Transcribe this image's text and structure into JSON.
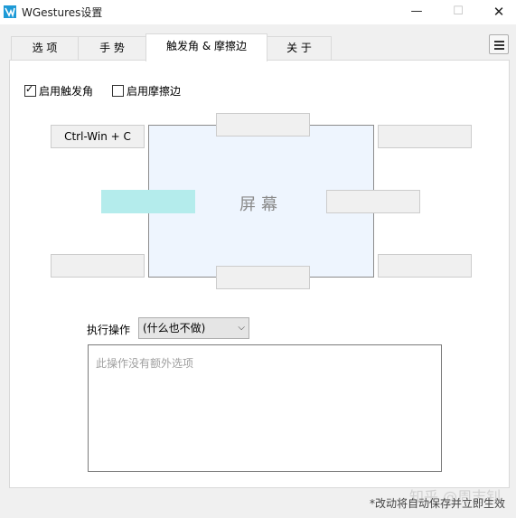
{
  "window": {
    "title": "WGestures设置",
    "min_glyph": "—",
    "max_glyph": "☐",
    "close_glyph": "✕"
  },
  "tabs": [
    {
      "label": "选 项",
      "active": false
    },
    {
      "label": "手 势",
      "active": false
    },
    {
      "label": "触发角 & 摩擦边",
      "active": true
    },
    {
      "label": "关 于",
      "active": false
    }
  ],
  "checkboxes": {
    "corner": {
      "label": "启用触发角",
      "checked": true,
      "mark": "✓"
    },
    "edge": {
      "label": "启用摩擦边",
      "checked": false
    }
  },
  "screen": {
    "label": "屏幕",
    "slots": {
      "top_left": "Ctrl-Win + C",
      "top_edge": "",
      "top_right": "",
      "left_edge": "",
      "right_edge": "",
      "bottom_left": "",
      "bottom_edge": "",
      "bottom_right": ""
    },
    "selected_slot": "left_edge",
    "selected_color": "#b4ecec"
  },
  "action": {
    "label": "执行操作",
    "selected": "(什么也不做)",
    "caret": "⌵",
    "options_text": "此操作没有额外选项"
  },
  "footer_note": "*改动将自动保存并立即生效",
  "watermark": "知乎 @周志钊"
}
